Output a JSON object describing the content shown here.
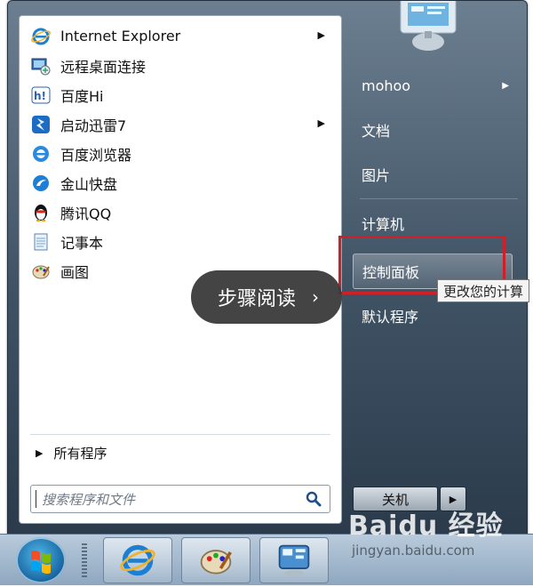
{
  "start_menu": {
    "programs": [
      {
        "label": "Internet Explorer",
        "icon": "internet-explorer-icon",
        "has_submenu": true
      },
      {
        "label": "远程桌面连接",
        "icon": "remote-desktop-icon",
        "has_submenu": false
      },
      {
        "label": "百度Hi",
        "icon": "baidu-hi-icon",
        "has_submenu": false
      },
      {
        "label": "启动迅雷7",
        "icon": "thunder-icon",
        "has_submenu": true
      },
      {
        "label": "百度浏览器",
        "icon": "baidu-browser-icon",
        "has_submenu": false
      },
      {
        "label": "金山快盘",
        "icon": "kuaipan-icon",
        "has_submenu": false
      },
      {
        "label": "腾讯QQ",
        "icon": "qq-penguin-icon",
        "has_submenu": false
      },
      {
        "label": "记事本",
        "icon": "notepad-icon",
        "has_submenu": false
      },
      {
        "label": "画图",
        "icon": "paint-icon",
        "has_submenu": false
      }
    ],
    "all_programs_label": "所有程序",
    "search_placeholder": "搜索程序和文件",
    "right_items": {
      "user": "mohoo",
      "documents": "文档",
      "pictures": "图片",
      "computer": "计算机",
      "control_panel": "控制面板",
      "default_programs": "默认程序"
    },
    "tooltip": "更改您的计算",
    "shutdown_label": "关机"
  },
  "overlay": {
    "label": "步骤阅读",
    "chevron": "›"
  },
  "watermark": {
    "brand": "Baidu 经验",
    "url": "jingyan.baidu.com"
  },
  "colors": {
    "highlight_box": "#cf1f27",
    "menu_dark": "#3f5264"
  }
}
